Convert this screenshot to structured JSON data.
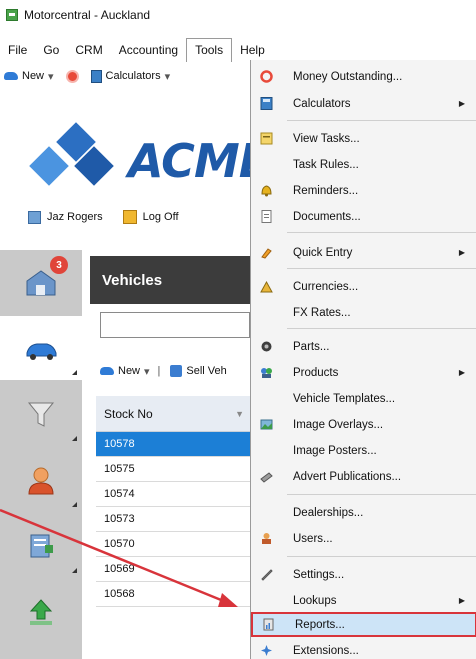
{
  "window": {
    "title": "Motorcentral - Auckland"
  },
  "menubar": [
    "File",
    "Go",
    "CRM",
    "Accounting",
    "Tools",
    "Help"
  ],
  "toolbar": {
    "new_label": "New",
    "calculators_label": "Calculators"
  },
  "logo": {
    "brand": "ACME"
  },
  "user": {
    "name": "Jaz Rogers",
    "logoff_label": "Log Off"
  },
  "nav": {
    "badge_count": "3"
  },
  "vehicles": {
    "title": "Vehicles",
    "toolbar_new": "New",
    "toolbar_sell": "Sell Veh",
    "column_header": "Stock No",
    "rows": [
      "10578",
      "10575",
      "10574",
      "10573",
      "10570",
      "10569",
      "10568"
    ]
  },
  "tools_menu": {
    "items": [
      {
        "label": "Money Outstanding...",
        "icon": "money-outstanding-icon"
      },
      {
        "label": "Calculators",
        "icon": "calculator-icon",
        "submenu": true
      },
      {
        "label": "View Tasks...",
        "icon": "tasks-icon"
      },
      {
        "label": "Task Rules...",
        "icon": ""
      },
      {
        "label": "Reminders...",
        "icon": "reminders-icon"
      },
      {
        "label": "Documents...",
        "icon": "documents-icon"
      },
      {
        "label": "Quick Entry",
        "icon": "quick-entry-icon",
        "submenu": true
      },
      {
        "label": "Currencies...",
        "icon": "currencies-icon"
      },
      {
        "label": "FX Rates...",
        "icon": ""
      },
      {
        "label": "Parts...",
        "icon": "parts-icon"
      },
      {
        "label": "Products",
        "icon": "products-icon",
        "submenu": true
      },
      {
        "label": "Vehicle Templates...",
        "icon": ""
      },
      {
        "label": "Image Overlays...",
        "icon": "image-overlays-icon"
      },
      {
        "label": "Image Posters...",
        "icon": ""
      },
      {
        "label": "Advert Publications...",
        "icon": "advert-icon"
      },
      {
        "label": "Dealerships...",
        "icon": ""
      },
      {
        "label": "Users...",
        "icon": "users-icon"
      },
      {
        "label": "Settings...",
        "icon": "settings-icon"
      },
      {
        "label": "Lookups",
        "icon": "",
        "submenu": true
      },
      {
        "label": "Reports...",
        "icon": "reports-icon",
        "highlighted": true
      },
      {
        "label": "Extensions...",
        "icon": "extensions-icon"
      }
    ],
    "submenu_arrow": "▶"
  },
  "colors": {
    "accent": "#1c7fd6",
    "highlight_border": "#d8343b",
    "header_dark": "#3c3c3c",
    "brand_blue": "#1f5aa8"
  }
}
